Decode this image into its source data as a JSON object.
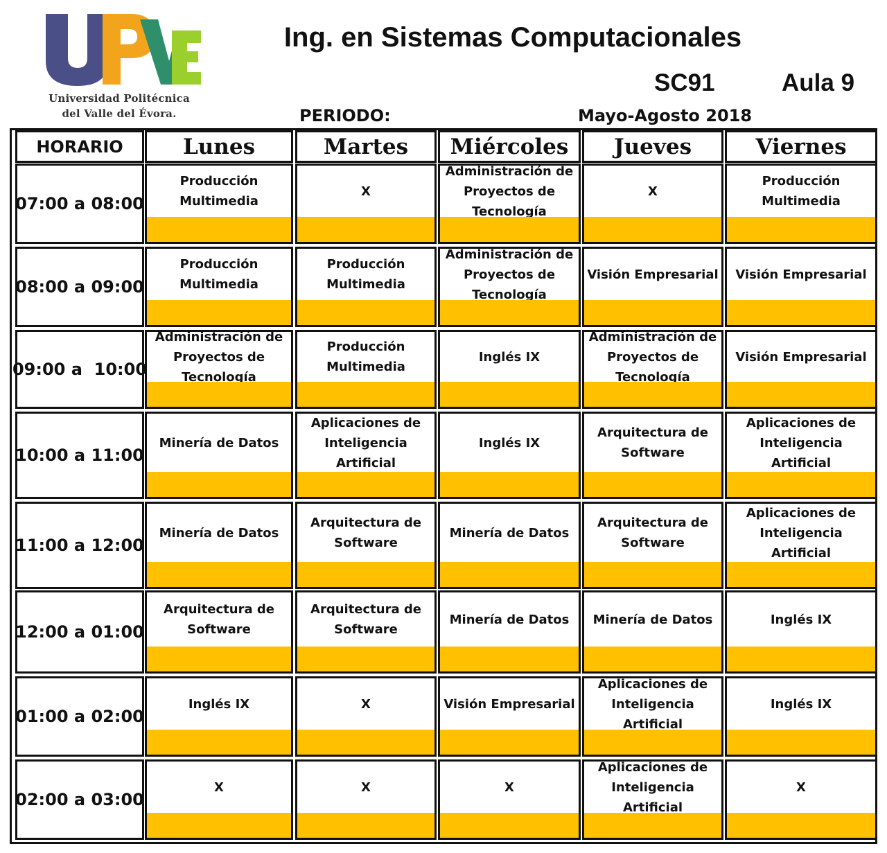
{
  "header": {
    "university_line1": "Universidad Politécnica",
    "university_line2": "del Valle del Évora.",
    "title": "Ing. en Sistemas Computacionales",
    "group": "SC91",
    "room": "Aula 9",
    "period_label": "PERIODO:",
    "period_value": "Mayo-Agosto 2018"
  },
  "colors": {
    "logo_u": "#4a4f88",
    "logo_p": "#f2a51c",
    "logo_v": "#2f8f6a",
    "logo_e": "#9bcf2e",
    "highlight_bar": "#ffc000"
  },
  "schedule": {
    "time_header": "HORARIO",
    "days": [
      "Lunes",
      "Martes",
      "Miércoles",
      "Jueves",
      "Viernes"
    ],
    "rows": [
      {
        "time": "07:00 a 08:00",
        "cells": [
          "Producción\nMultimedia",
          "X",
          "Administración de\nProyectos de\nTecnología",
          "X",
          "Producción Multimedia"
        ]
      },
      {
        "time": "08:00 a 09:00",
        "cells": [
          "Producción\nMultimedia",
          "Producción\nMultimedia",
          "Administración de\nProyectos de\nTecnología",
          "Visión Empresarial",
          "Visión Empresarial"
        ]
      },
      {
        "time": "09:00 a  10:00",
        "cells": [
          "Administración de\nProyectos de\nTecnología",
          "Producción\nMultimedia",
          "Inglés IX",
          "Administración de\nProyectos de\nTecnología",
          "Visión Empresarial"
        ]
      },
      {
        "time": "10:00 a 11:00",
        "cells": [
          "Minería de Datos",
          "Aplicaciones de\nInteligencia Artificial",
          "Inglés IX",
          "Arquitectura de\nSoftware",
          "Aplicaciones de\nInteligencia Artificial"
        ]
      },
      {
        "time": "11:00 a 12:00",
        "cells": [
          "Minería de Datos",
          "Arquitectura de\nSoftware",
          "Minería de Datos",
          "Arquitectura de\nSoftware",
          "Aplicaciones de\nInteligencia Artificial"
        ]
      },
      {
        "time": "12:00 a 01:00",
        "cells": [
          "Arquitectura de\nSoftware",
          "Arquitectura de\nSoftware",
          "Minería de Datos",
          "Minería de Datos",
          "Inglés IX"
        ]
      },
      {
        "time": "01:00 a 02:00",
        "cells": [
          "Inglés IX",
          "X",
          "Visión Empresarial",
          "Aplicaciones de\nInteligencia Artificial",
          "Inglés IX"
        ]
      },
      {
        "time": "02:00 a 03:00",
        "cells": [
          "X",
          "X",
          "X",
          "Aplicaciones de\nInteligencia Artificial",
          "X"
        ]
      }
    ]
  }
}
